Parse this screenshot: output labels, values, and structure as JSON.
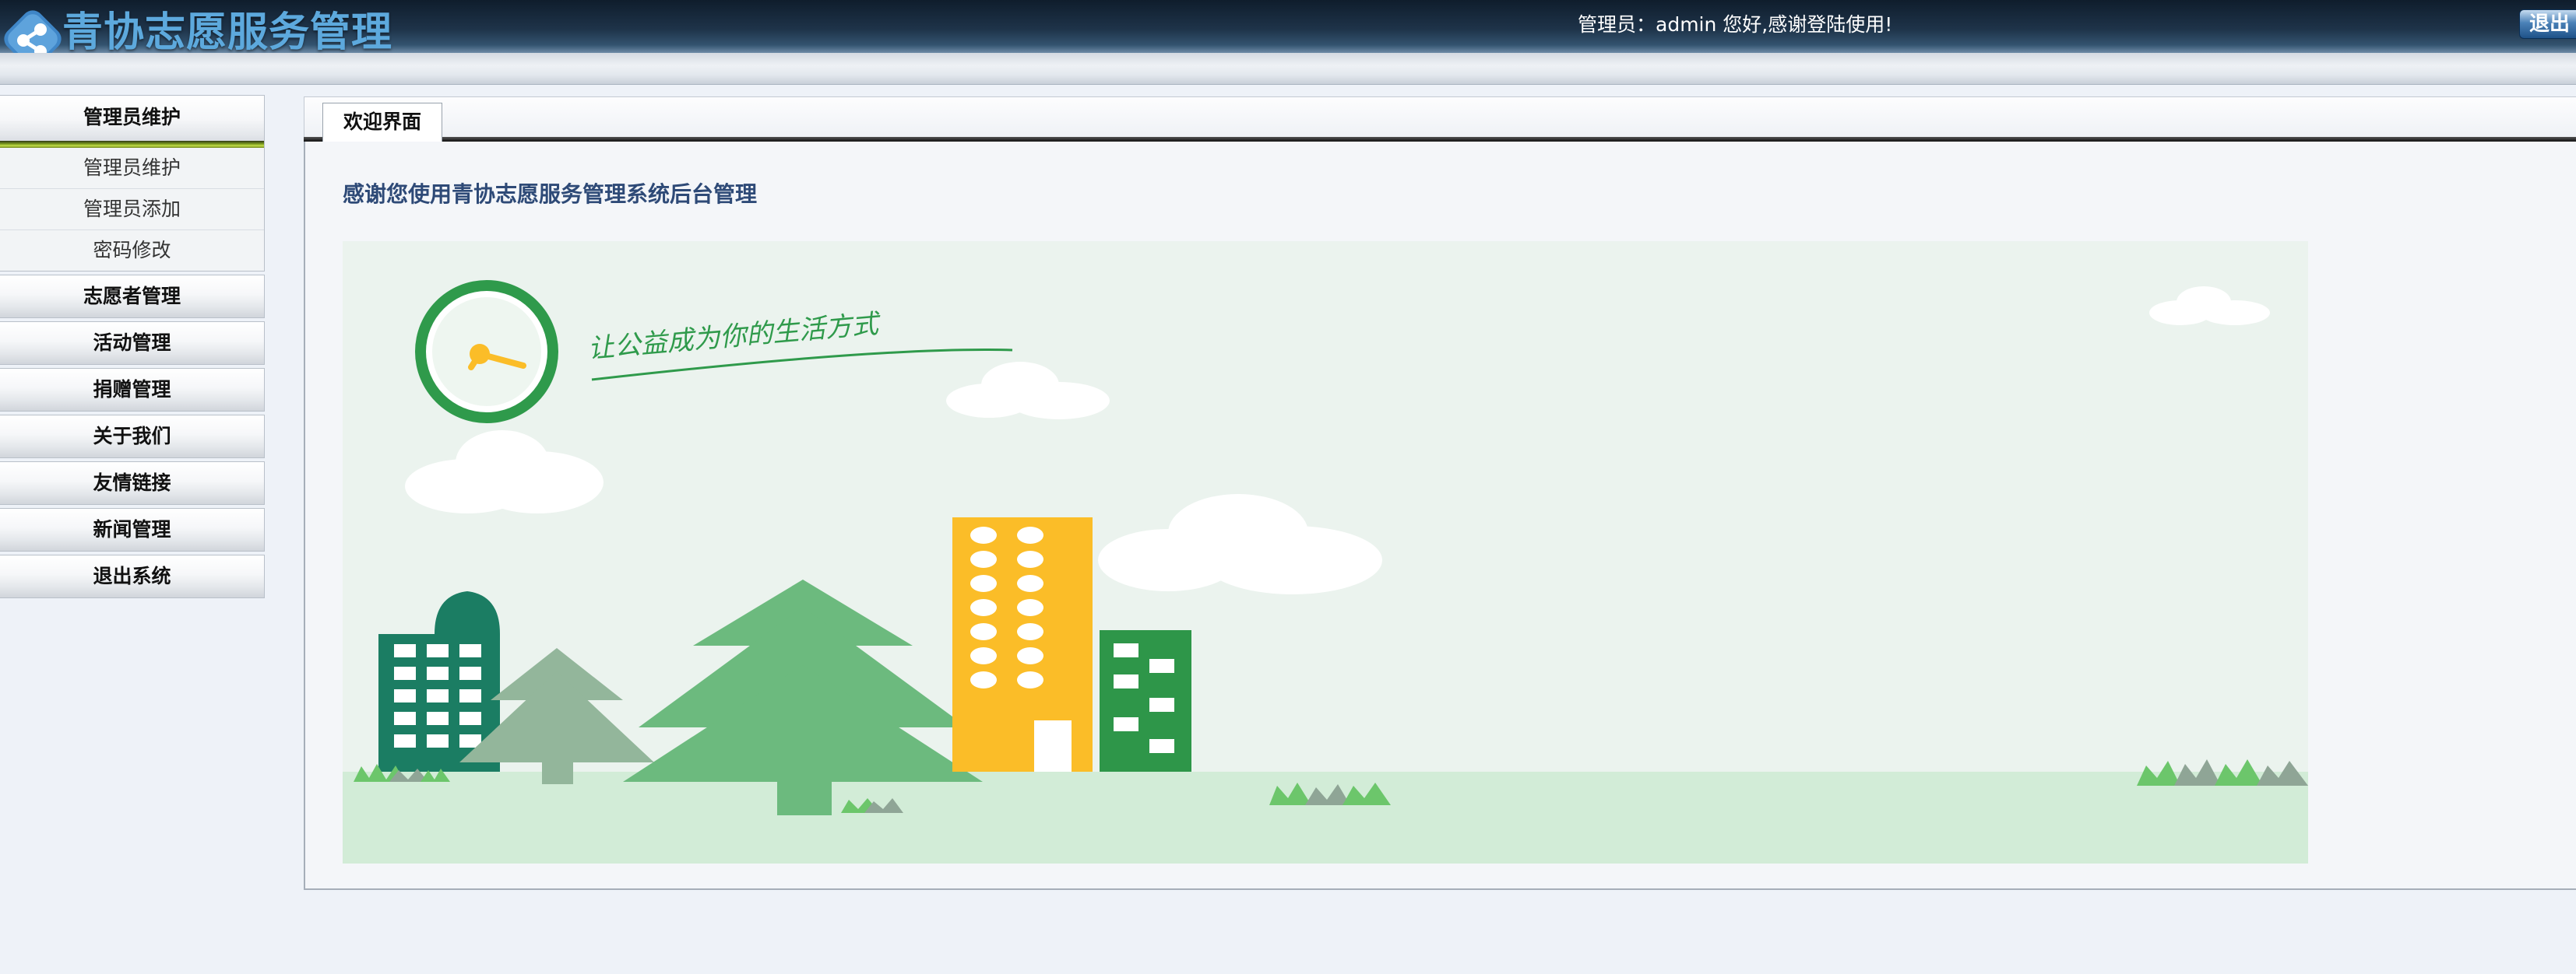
{
  "header": {
    "app_title": "青协志愿服务管理",
    "greeting": "管理员：admin 您好,感谢登陆使用!",
    "logout_label": "退出"
  },
  "sidebar": {
    "groups": [
      {
        "label": "管理员维护",
        "expanded": true,
        "items": [
          {
            "label": "管理员维护"
          },
          {
            "label": "管理员添加"
          },
          {
            "label": "密码修改"
          }
        ]
      },
      {
        "label": "志愿者管理",
        "expanded": false
      },
      {
        "label": "活动管理",
        "expanded": false
      },
      {
        "label": "捐赠管理",
        "expanded": false
      },
      {
        "label": "关于我们",
        "expanded": false
      },
      {
        "label": "友情链接",
        "expanded": false
      },
      {
        "label": "新闻管理",
        "expanded": false
      },
      {
        "label": "退出系统",
        "expanded": false
      }
    ]
  },
  "content": {
    "tabs": [
      {
        "label": "欢迎界面",
        "active": true
      }
    ],
    "welcome_message": "感谢您使用青协志愿服务管理系统后台管理",
    "illustration": {
      "slogan": "让公益成为你的生活方式",
      "icons": [
        "clock-icon",
        "cloud",
        "building",
        "tree",
        "grass"
      ]
    }
  },
  "colors": {
    "header_bg": "#1e3349",
    "title_blue": "#5da9dd",
    "welcome_text": "#2e4a77",
    "illustration_sky": "#ebf3ee",
    "illustration_ground": "#d2ecd7",
    "building_teal": "#1b7d63",
    "building_yellow": "#fbbd28",
    "building_green": "#2e9649",
    "tree_green": "#6cba7e",
    "tree_grey": "#93b69b"
  }
}
